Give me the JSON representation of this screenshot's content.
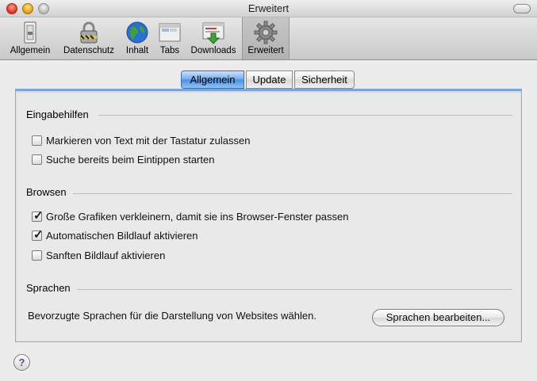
{
  "window": {
    "title": "Erweitert"
  },
  "toolbar": {
    "items": [
      {
        "label": "Allgemein",
        "icon": "general-switch-icon",
        "active": false
      },
      {
        "label": "Datenschutz",
        "icon": "padlock-icon",
        "active": false
      },
      {
        "label": "Inhalt",
        "icon": "globe-icon",
        "active": false
      },
      {
        "label": "Tabs",
        "icon": "tabs-window-icon",
        "active": false
      },
      {
        "label": "Downloads",
        "icon": "downloads-icon",
        "active": false
      },
      {
        "label": "Erweitert",
        "icon": "gear-icon",
        "active": true
      }
    ]
  },
  "tabs": [
    {
      "label": "Allgemein",
      "selected": true
    },
    {
      "label": "Update",
      "selected": false
    },
    {
      "label": "Sicherheit",
      "selected": false
    }
  ],
  "sections": {
    "accessibility": {
      "title": "Eingabehilfen",
      "options": [
        {
          "label": "Markieren von Text mit der Tastatur zulassen",
          "checked": false
        },
        {
          "label": "Suche bereits beim Eintippen starten",
          "checked": false
        }
      ]
    },
    "browsing": {
      "title": "Browsen",
      "options": [
        {
          "label": "Große Grafiken verkleinern, damit sie ins Browser-Fenster passen",
          "checked": true
        },
        {
          "label": "Automatischen Bildlauf aktivieren",
          "checked": true
        },
        {
          "label": "Sanften Bildlauf aktivieren",
          "checked": false
        }
      ]
    },
    "languages": {
      "title": "Sprachen",
      "description": "Bevorzugte Sprachen für die Darstellung von Websites wählen.",
      "button_label": "Sprachen bearbeiten..."
    }
  },
  "help": {
    "label": "?"
  },
  "colors": {
    "accent": "#4a8fe3",
    "checkmark": "#1a1a1a"
  }
}
